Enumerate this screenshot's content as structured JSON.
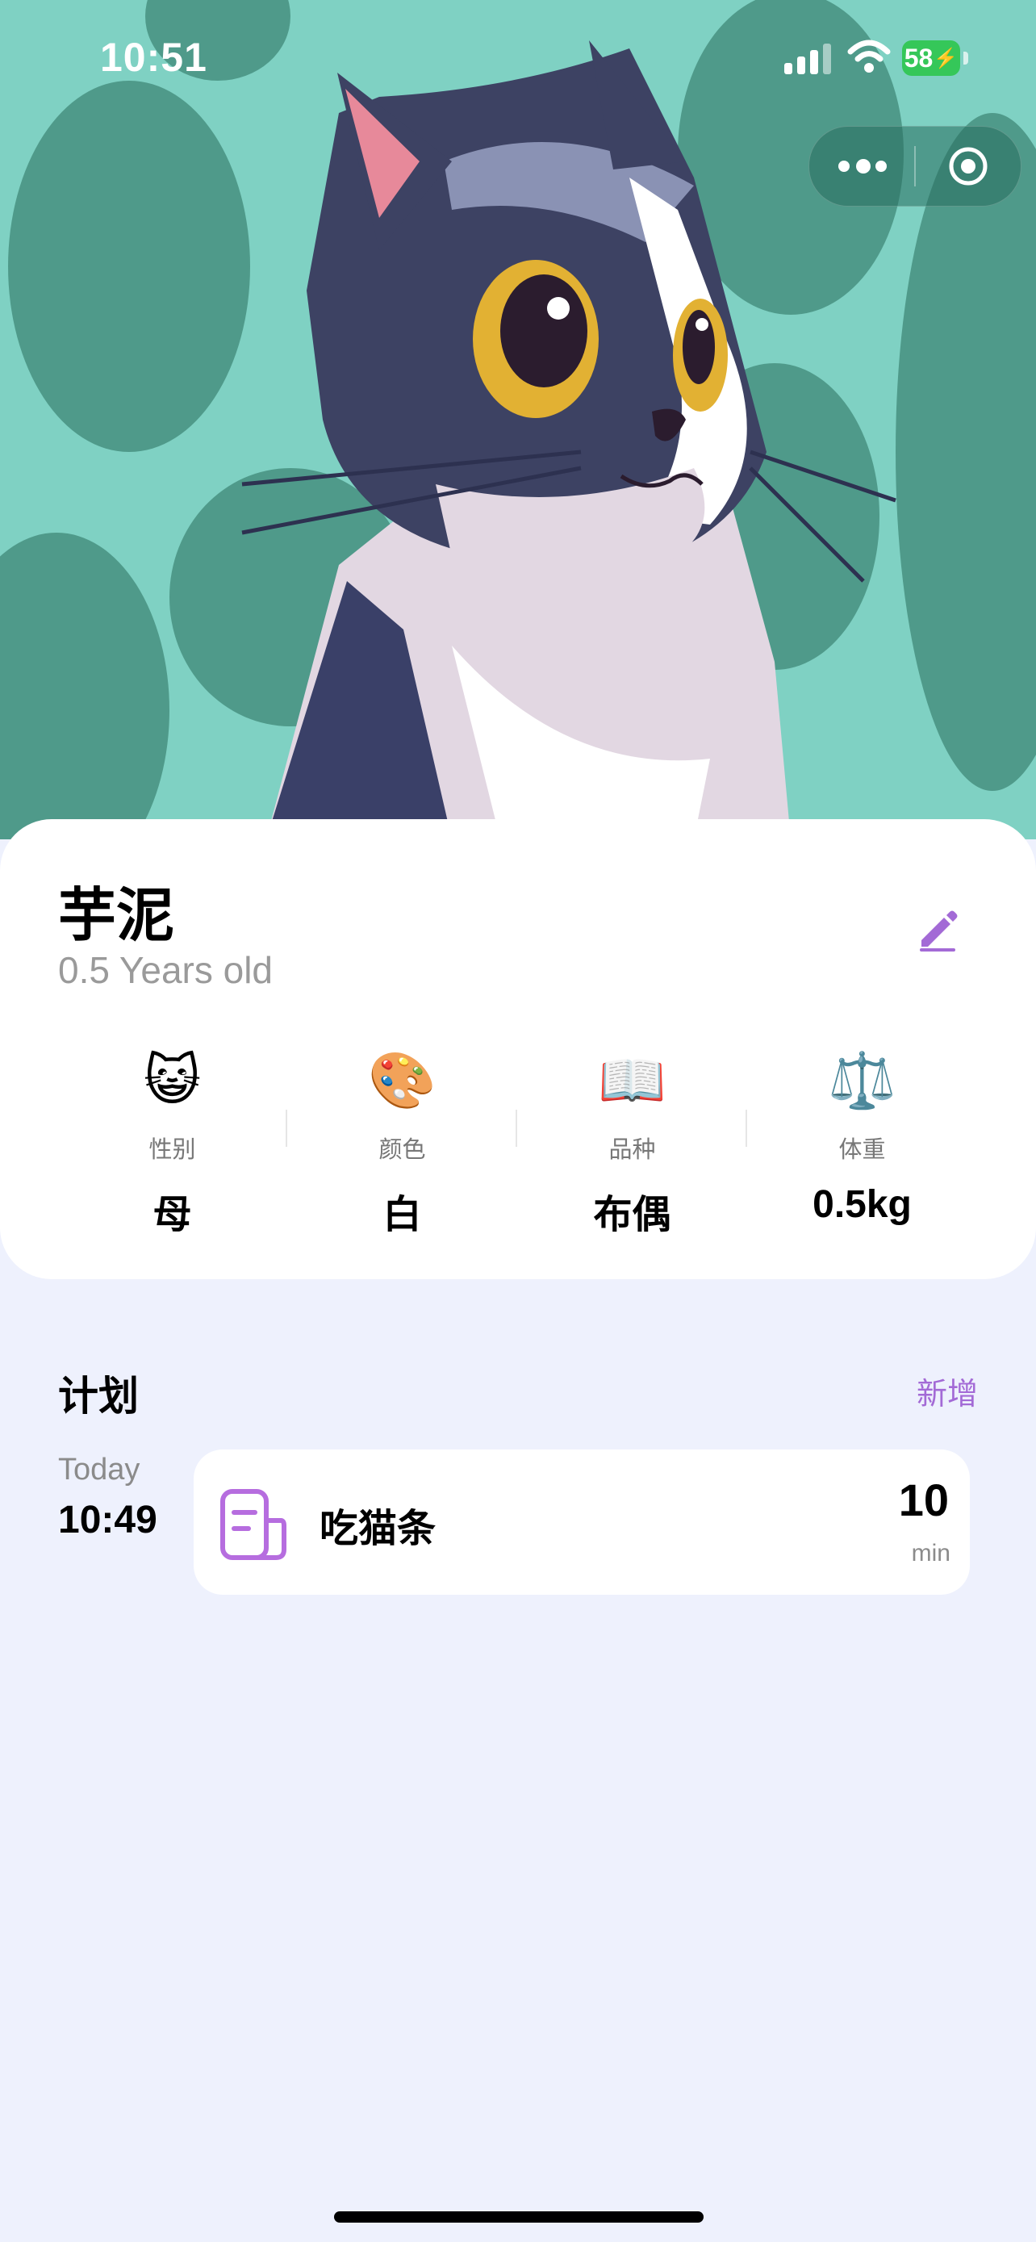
{
  "status_bar": {
    "time": "10:51",
    "battery": "58"
  },
  "pet": {
    "name": "芋泥",
    "age": "0.5 Years old",
    "stats": [
      {
        "emoji": "😺",
        "label": "性别",
        "value": "母"
      },
      {
        "emoji": "🎨",
        "label": "颜色",
        "value": "白"
      },
      {
        "emoji": "📖",
        "label": "品种",
        "value": "布偶"
      },
      {
        "emoji": "⚖️",
        "label": "体重",
        "value": "0.5kg"
      }
    ]
  },
  "plans": {
    "title": "计划",
    "add_label": "新增",
    "items": [
      {
        "day": "Today",
        "time": "10:49",
        "name": "吃猫条",
        "duration": "10",
        "unit": "min",
        "icon": "document-icon"
      }
    ]
  },
  "colors": {
    "accent": "#a36ad6",
    "hero_bg": "#7fd1c3",
    "page_bg": "#eef1fd"
  }
}
